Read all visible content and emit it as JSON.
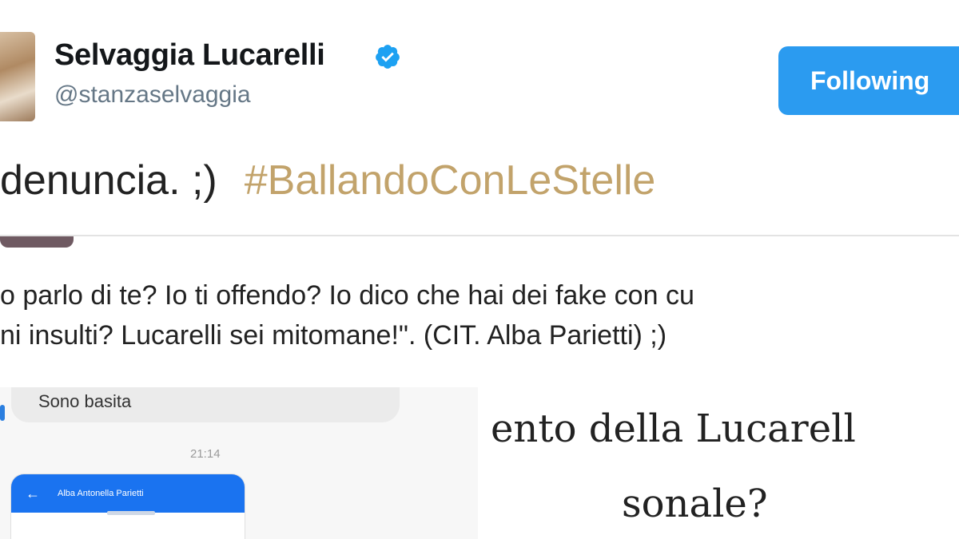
{
  "profile": {
    "name": "Selvaggia Lucarelli",
    "handle": "@stanzaselvaggia",
    "follow_label": "Following"
  },
  "tweet": {
    "text": "denuncia. ;)",
    "hashtag": "#BallandoConLeStelle"
  },
  "quote": {
    "line1": "o parlo di te? Io ti offendo? Io dico che hai dei fake con cu",
    "line2": "ni insulti? Lucarelli sei mitomane!\". (CIT. Alba Parietti) ;)"
  },
  "chat": {
    "message": "Sono basita",
    "time": "21:14",
    "contact_name": "Alba Antonella Parietti",
    "back_icon": "arrow-left-icon"
  },
  "article": {
    "line1": "ento della Lucarell",
    "line2": "sonale?"
  },
  "colors": {
    "follow_button": "#2b9bf0",
    "hashtag": "#c2a36b",
    "verified": "#1da1f2",
    "chat_header": "#1a73f0"
  }
}
